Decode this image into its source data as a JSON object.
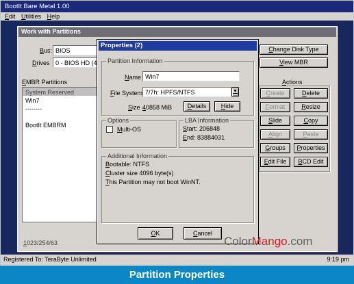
{
  "app": {
    "title": "BootIt Bare Metal 1.00",
    "menu": [
      "Edit",
      "Utilities",
      "Help"
    ]
  },
  "main_window": {
    "title": "Work with Partitions",
    "bus_label": "Bus:",
    "bus_value": "BIOS",
    "drives_label": "Drives",
    "drives_value": "0 - BIOS HD (4",
    "embr_label": "EMBR Partitions",
    "partitions": [
      "System Reserved",
      "Win7",
      "--------",
      "",
      "BootIt EMBRM"
    ],
    "geometry": "1023/254/63",
    "buttons_top": [
      "Change Disk Type",
      "View MBR"
    ],
    "actions_label": "Actions",
    "actions": [
      [
        "Create",
        "Delete"
      ],
      [
        "Format",
        "Resize"
      ],
      [
        "Slide",
        "Copy"
      ],
      [
        "Align",
        "Paste"
      ],
      [
        "Groups",
        "Properties"
      ],
      [
        "Edit File",
        "BCD Edit"
      ]
    ]
  },
  "dialog": {
    "title": "Properties (2)",
    "partition_info": {
      "label": "Partition Information",
      "name_label": "Name",
      "name_value": "Win7",
      "fs_label": "File System",
      "fs_value": "7/7h: HPFS/NTFS",
      "size_label": "Size",
      "size_value": "40858 MiB",
      "details_button": "Details",
      "hide_button": "Hide"
    },
    "options": {
      "label": "Options",
      "multi_os": "Multi-OS"
    },
    "lba": {
      "label": "LBA Information",
      "start": "Start: 206848",
      "end": "End: 83884031"
    },
    "additional": {
      "label": "Additional Information",
      "lines": [
        "Bootable: NTFS",
        "Cluster size 4096 byte(s)",
        "This Partition may not boot WinNT."
      ]
    },
    "ok_button": "OK",
    "cancel_button": "Cancel"
  },
  "status": {
    "registered": "Registered To: TeraByte Unlimited",
    "time": "9:19 pm"
  },
  "watermark": {
    "a": "Color",
    "b": "Mango",
    "c": ".com"
  },
  "caption": "Partition Properties"
}
